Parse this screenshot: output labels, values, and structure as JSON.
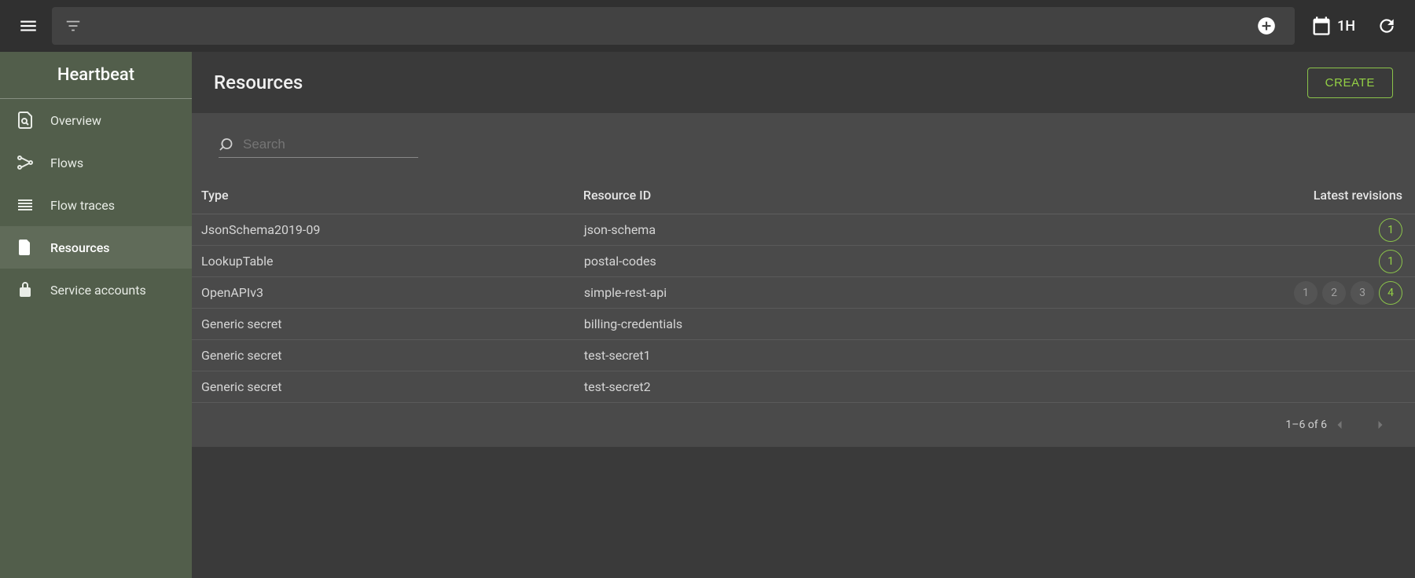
{
  "topbar": {
    "time_range": "1H"
  },
  "sidebar": {
    "title": "Heartbeat",
    "items": [
      {
        "label": "Overview"
      },
      {
        "label": "Flows"
      },
      {
        "label": "Flow traces"
      },
      {
        "label": "Resources"
      },
      {
        "label": "Service accounts"
      }
    ],
    "selected_index": 3
  },
  "header": {
    "title": "Resources",
    "create_label": "CREATE"
  },
  "search": {
    "placeholder": "Search"
  },
  "table": {
    "columns": [
      "Type",
      "Resource ID",
      "Latest revisions"
    ],
    "rows": [
      {
        "type": "JsonSchema2019-09",
        "id": "json-schema",
        "revisions": [
          1
        ],
        "latest": 1
      },
      {
        "type": "LookupTable",
        "id": "postal-codes",
        "revisions": [
          1
        ],
        "latest": 1
      },
      {
        "type": "OpenAPIv3",
        "id": "simple-rest-api",
        "revisions": [
          1,
          2,
          3,
          4
        ],
        "latest": 4
      },
      {
        "type": "Generic secret",
        "id": "billing-credentials",
        "revisions": [],
        "latest": null
      },
      {
        "type": "Generic secret",
        "id": "test-secret1",
        "revisions": [],
        "latest": null
      },
      {
        "type": "Generic secret",
        "id": "test-secret2",
        "revisions": [],
        "latest": null
      }
    ]
  },
  "pager": {
    "text": "1–6 of 6"
  }
}
